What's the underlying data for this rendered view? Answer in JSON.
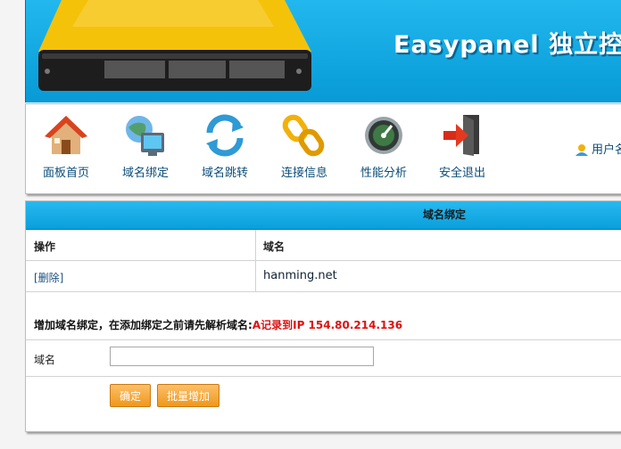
{
  "header": {
    "brand": "Easypanel 独立控"
  },
  "toolbar": {
    "items": [
      {
        "label": "面板首页",
        "icon": "house-icon"
      },
      {
        "label": "域名绑定",
        "icon": "domain-bind-icon"
      },
      {
        "label": "域名跳转",
        "icon": "refresh-arrows-icon"
      },
      {
        "label": "连接信息",
        "icon": "chain-link-icon"
      },
      {
        "label": "性能分析",
        "icon": "gauge-icon"
      },
      {
        "label": "安全退出",
        "icon": "exit-door-icon"
      }
    ],
    "user_label": "用户名"
  },
  "panel": {
    "title": "域名绑定",
    "columns": [
      "操作",
      "域名"
    ],
    "rows": [
      {
        "action": "[删除]",
        "domain": "hanming.net"
      }
    ],
    "notice": "增加域名绑定，在添加绑定之前请先解析域名:",
    "notice_highlight": "A记录到IP 154.80.214.136",
    "form": {
      "label": "域名",
      "value": "",
      "placeholder": ""
    },
    "buttons": {
      "confirm": "确定",
      "batch_add": "批量增加"
    }
  },
  "colors": {
    "accent": "#0aa1df",
    "button": "#f0971a",
    "highlight": "#e01010"
  }
}
